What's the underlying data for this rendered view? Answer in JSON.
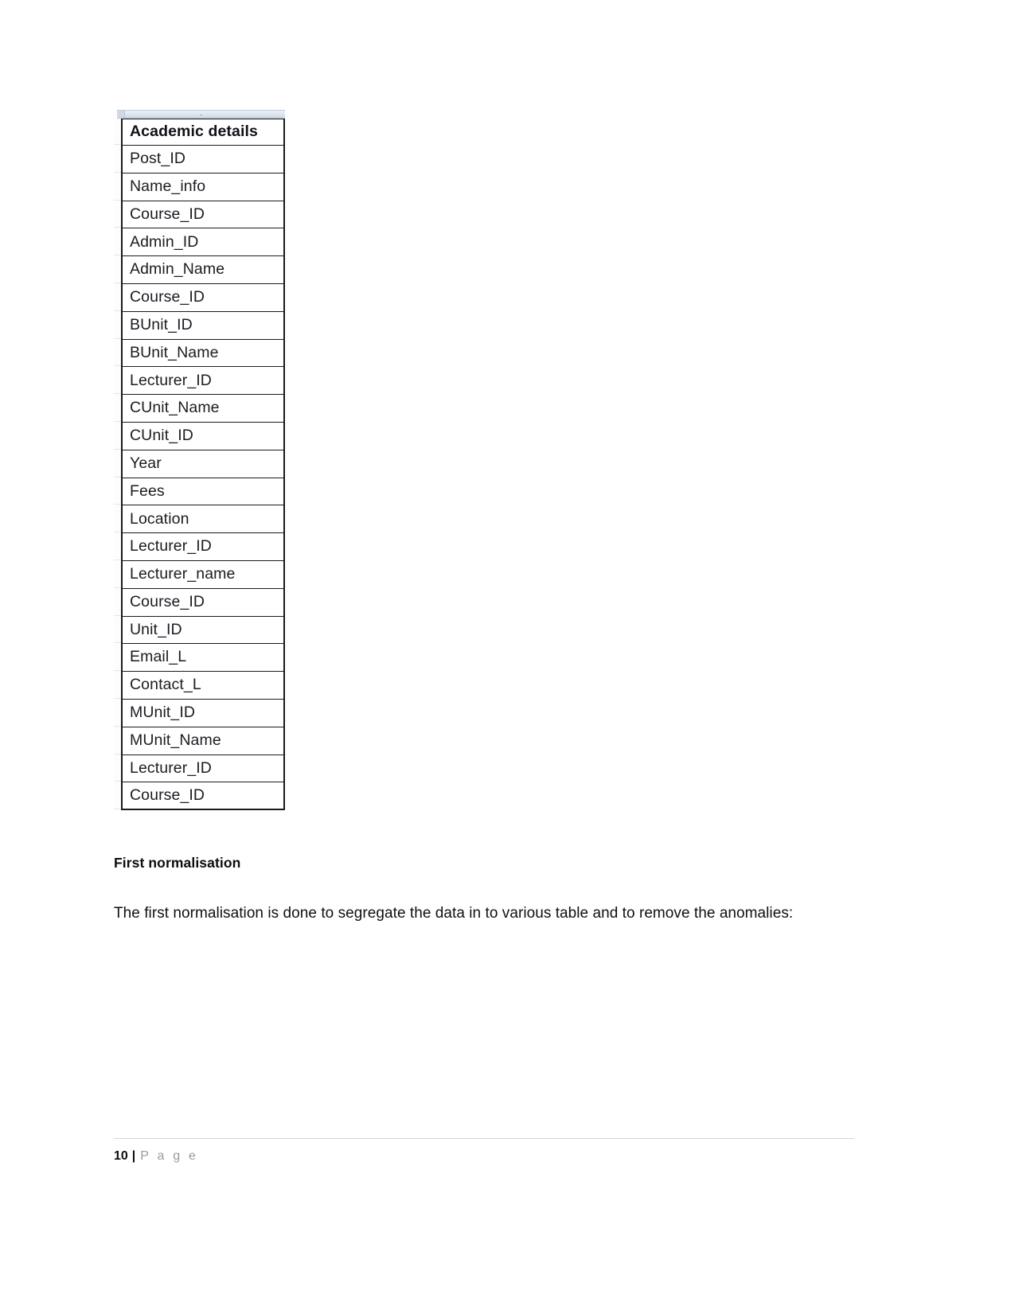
{
  "document": {
    "page_number": "10",
    "spreadsheet": {
      "column_header_mark": "..",
      "header_cell": "Academic details",
      "rows": [
        "Post_ID",
        "Name_info",
        "Course_ID",
        "Admin_ID",
        "Admin_Name",
        "Course_ID",
        "BUnit_ID",
        "BUnit_Name",
        "Lecturer_ID",
        "CUnit_Name",
        "CUnit_ID",
        "Year",
        "Fees",
        "Location",
        "Lecturer_ID",
        "Lecturer_name",
        "Course_ID",
        "Unit_ID",
        "Email_L",
        "Contact_L",
        "MUnit_ID",
        "MUnit_Name",
        "Lecturer_ID",
        "Course_ID"
      ]
    },
    "heading": "First normalisation",
    "paragraph": "The first normalisation is done to segregate the data in to various table and to remove the anomalies:",
    "footer": {
      "page_number": "10",
      "separator": "|",
      "label": "P a g e"
    }
  },
  "colors": {
    "text": "#101010",
    "muted_text": "#9a9a9a",
    "table_border": "#1a1a1a",
    "sheet_header_bg": "#dde5ef",
    "rule": "#d4d4d4",
    "page_bg": "#ffffff"
  }
}
